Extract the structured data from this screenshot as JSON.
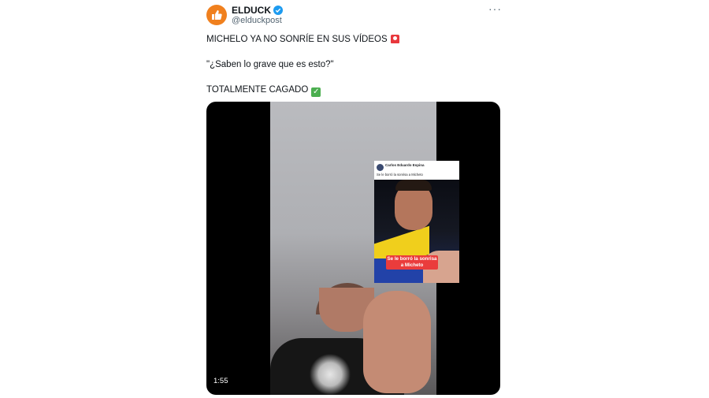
{
  "author": {
    "name": "ELDUCK",
    "handle": "@elduckpost",
    "verified": true,
    "avatar_icon": "thumbs-up-icon",
    "avatar_color": "#f0801e"
  },
  "menu": {
    "more_icon": "more-horizontal-icon",
    "label": "···"
  },
  "tweet": {
    "line1": "MICHELO YA NO SONRÍE EN SUS VÍDEOS",
    "line1_emoji": "police-light-emoji",
    "line2": "\"¿Saben lo grave que es esto?\"",
    "line3": "TOTALMENTE CAGADO",
    "line3_emoji": "check-mark-button-emoji"
  },
  "video": {
    "duration": "1:55",
    "embedded_post": {
      "author_name": "Carlos Eduardo Espina",
      "caption": "Se le borró la sonrisa a Micheto",
      "sticker_line1": "Se le borró la sonrisa",
      "sticker_line2": "a Micheto"
    }
  },
  "colors": {
    "accent_verified": "#1d9bf0",
    "text_primary": "#0f1419",
    "text_secondary": "#536471",
    "sticker": "#ea3c3c"
  }
}
